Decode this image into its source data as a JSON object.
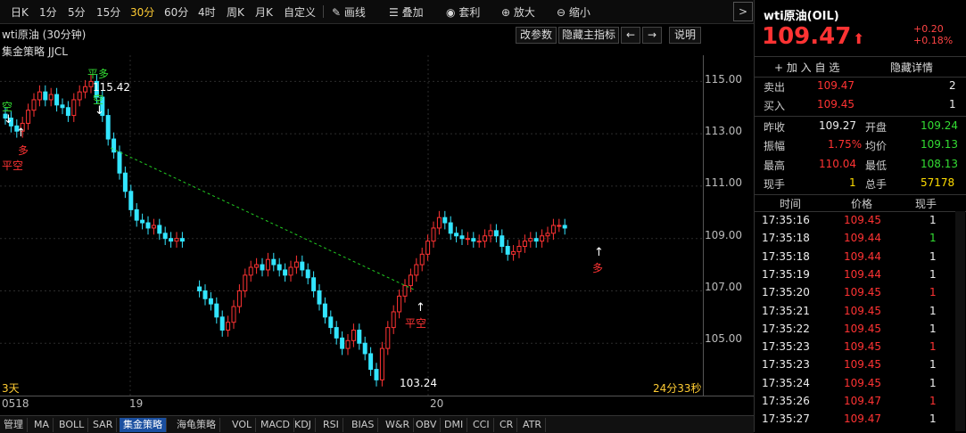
{
  "toolbar": {
    "periods": [
      "日K",
      "1分",
      "5分",
      "15分",
      "30分",
      "60分",
      "4时",
      "周K",
      "月K",
      "自定义"
    ],
    "active_period": "30分",
    "tools": [
      "画线",
      "叠加",
      "套利",
      "放大",
      "缩小"
    ],
    "next": ">"
  },
  "chart": {
    "title": "wti原油 (30分钟)",
    "strategy": "集金策略 JJCL",
    "buttons": [
      "改参数",
      "隐藏主指标",
      "←",
      "→",
      "说明"
    ],
    "range_label": "3天",
    "countdown": "24分33秒",
    "high_label": "115.42",
    "low_label": "103.24",
    "signals": [
      "平多",
      "空",
      "空",
      "多",
      "平空",
      "平空",
      "多"
    ],
    "colors": {
      "up": "#ff3333",
      "down": "#33e5ff",
      "signal_up": "#ff3333",
      "signal_down": "#33dd33",
      "trend": "#22cc22"
    }
  },
  "chart_data": {
    "type": "candlestick",
    "y_ticks": [
      "115.00",
      "113.00",
      "111.00",
      "109.00",
      "107.00",
      "105.00"
    ],
    "x_labels": [
      "0518",
      "19",
      "20"
    ],
    "ylim": [
      103.0,
      116.0
    ]
  },
  "bottom_tabs": [
    "管理",
    "MA",
    "BOLL",
    "SAR",
    "集金策略",
    "海龟策略",
    "VOL",
    "MACD",
    "KDJ",
    "RSI",
    "BIAS",
    "W&R",
    "OBV",
    "DMI",
    "CCI",
    "CR",
    "ATR"
  ],
  "active_tab": "集金策略",
  "quote": {
    "symbol": "wti原油(OIL)",
    "last": "109.47",
    "change": "+0.20",
    "change_pct": "+0.18%",
    "add_fav": "+ 加 入 自 选",
    "hide_detail": "隐藏详情",
    "sell_label": "卖出",
    "sell_price": "109.47",
    "sell_vol": "2",
    "buy_label": "买入",
    "buy_price": "109.45",
    "buy_vol": "1",
    "prev_close_label": "昨收",
    "prev_close": "109.27",
    "open_label": "开盘",
    "open": "109.24",
    "amp_label": "振幅",
    "amp": "1.75%",
    "avg_label": "均价",
    "avg": "109.13",
    "high_label": "最高",
    "high": "110.04",
    "low_label": "最低",
    "low": "108.13",
    "cur_vol_label": "现手",
    "cur_vol": "1",
    "total_vol_label": "总手",
    "total_vol": "57178"
  },
  "ticks": {
    "headers": [
      "时间",
      "价格",
      "现手"
    ],
    "rows": [
      {
        "time": "17:35:16",
        "price": "109.45",
        "vol": "1",
        "pc": "red",
        "vc": "white"
      },
      {
        "time": "17:35:18",
        "price": "109.44",
        "vol": "1",
        "pc": "red",
        "vc": "green"
      },
      {
        "time": "17:35:18",
        "price": "109.44",
        "vol": "1",
        "pc": "red",
        "vc": "white"
      },
      {
        "time": "17:35:19",
        "price": "109.44",
        "vol": "1",
        "pc": "red",
        "vc": "white"
      },
      {
        "time": "17:35:20",
        "price": "109.45",
        "vol": "1",
        "pc": "red",
        "vc": "red"
      },
      {
        "time": "17:35:21",
        "price": "109.45",
        "vol": "1",
        "pc": "red",
        "vc": "white"
      },
      {
        "time": "17:35:22",
        "price": "109.45",
        "vol": "1",
        "pc": "red",
        "vc": "white"
      },
      {
        "time": "17:35:23",
        "price": "109.45",
        "vol": "1",
        "pc": "red",
        "vc": "red"
      },
      {
        "time": "17:35:23",
        "price": "109.45",
        "vol": "1",
        "pc": "red",
        "vc": "white"
      },
      {
        "time": "17:35:24",
        "price": "109.45",
        "vol": "1",
        "pc": "red",
        "vc": "white"
      },
      {
        "time": "17:35:26",
        "price": "109.47",
        "vol": "1",
        "pc": "red",
        "vc": "red"
      },
      {
        "time": "17:35:27",
        "price": "109.47",
        "vol": "1",
        "pc": "red",
        "vc": "white"
      }
    ]
  }
}
